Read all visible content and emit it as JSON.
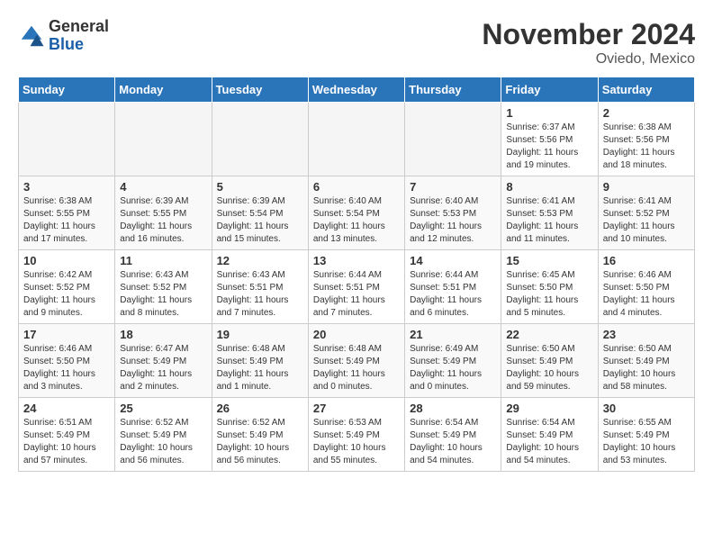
{
  "logo": {
    "general": "General",
    "blue": "Blue"
  },
  "title": "November 2024",
  "location": "Oviedo, Mexico",
  "days_of_week": [
    "Sunday",
    "Monday",
    "Tuesday",
    "Wednesday",
    "Thursday",
    "Friday",
    "Saturday"
  ],
  "weeks": [
    [
      {
        "day": "",
        "info": "",
        "empty": true
      },
      {
        "day": "",
        "info": "",
        "empty": true
      },
      {
        "day": "",
        "info": "",
        "empty": true
      },
      {
        "day": "",
        "info": "",
        "empty": true
      },
      {
        "day": "",
        "info": "",
        "empty": true
      },
      {
        "day": "1",
        "info": "Sunrise: 6:37 AM\nSunset: 5:56 PM\nDaylight: 11 hours and 19 minutes.",
        "empty": false
      },
      {
        "day": "2",
        "info": "Sunrise: 6:38 AM\nSunset: 5:56 PM\nDaylight: 11 hours and 18 minutes.",
        "empty": false
      }
    ],
    [
      {
        "day": "3",
        "info": "Sunrise: 6:38 AM\nSunset: 5:55 PM\nDaylight: 11 hours and 17 minutes.",
        "empty": false
      },
      {
        "day": "4",
        "info": "Sunrise: 6:39 AM\nSunset: 5:55 PM\nDaylight: 11 hours and 16 minutes.",
        "empty": false
      },
      {
        "day": "5",
        "info": "Sunrise: 6:39 AM\nSunset: 5:54 PM\nDaylight: 11 hours and 15 minutes.",
        "empty": false
      },
      {
        "day": "6",
        "info": "Sunrise: 6:40 AM\nSunset: 5:54 PM\nDaylight: 11 hours and 13 minutes.",
        "empty": false
      },
      {
        "day": "7",
        "info": "Sunrise: 6:40 AM\nSunset: 5:53 PM\nDaylight: 11 hours and 12 minutes.",
        "empty": false
      },
      {
        "day": "8",
        "info": "Sunrise: 6:41 AM\nSunset: 5:53 PM\nDaylight: 11 hours and 11 minutes.",
        "empty": false
      },
      {
        "day": "9",
        "info": "Sunrise: 6:41 AM\nSunset: 5:52 PM\nDaylight: 11 hours and 10 minutes.",
        "empty": false
      }
    ],
    [
      {
        "day": "10",
        "info": "Sunrise: 6:42 AM\nSunset: 5:52 PM\nDaylight: 11 hours and 9 minutes.",
        "empty": false
      },
      {
        "day": "11",
        "info": "Sunrise: 6:43 AM\nSunset: 5:52 PM\nDaylight: 11 hours and 8 minutes.",
        "empty": false
      },
      {
        "day": "12",
        "info": "Sunrise: 6:43 AM\nSunset: 5:51 PM\nDaylight: 11 hours and 7 minutes.",
        "empty": false
      },
      {
        "day": "13",
        "info": "Sunrise: 6:44 AM\nSunset: 5:51 PM\nDaylight: 11 hours and 7 minutes.",
        "empty": false
      },
      {
        "day": "14",
        "info": "Sunrise: 6:44 AM\nSunset: 5:51 PM\nDaylight: 11 hours and 6 minutes.",
        "empty": false
      },
      {
        "day": "15",
        "info": "Sunrise: 6:45 AM\nSunset: 5:50 PM\nDaylight: 11 hours and 5 minutes.",
        "empty": false
      },
      {
        "day": "16",
        "info": "Sunrise: 6:46 AM\nSunset: 5:50 PM\nDaylight: 11 hours and 4 minutes.",
        "empty": false
      }
    ],
    [
      {
        "day": "17",
        "info": "Sunrise: 6:46 AM\nSunset: 5:50 PM\nDaylight: 11 hours and 3 minutes.",
        "empty": false
      },
      {
        "day": "18",
        "info": "Sunrise: 6:47 AM\nSunset: 5:49 PM\nDaylight: 11 hours and 2 minutes.",
        "empty": false
      },
      {
        "day": "19",
        "info": "Sunrise: 6:48 AM\nSunset: 5:49 PM\nDaylight: 11 hours and 1 minute.",
        "empty": false
      },
      {
        "day": "20",
        "info": "Sunrise: 6:48 AM\nSunset: 5:49 PM\nDaylight: 11 hours and 0 minutes.",
        "empty": false
      },
      {
        "day": "21",
        "info": "Sunrise: 6:49 AM\nSunset: 5:49 PM\nDaylight: 11 hours and 0 minutes.",
        "empty": false
      },
      {
        "day": "22",
        "info": "Sunrise: 6:50 AM\nSunset: 5:49 PM\nDaylight: 10 hours and 59 minutes.",
        "empty": false
      },
      {
        "day": "23",
        "info": "Sunrise: 6:50 AM\nSunset: 5:49 PM\nDaylight: 10 hours and 58 minutes.",
        "empty": false
      }
    ],
    [
      {
        "day": "24",
        "info": "Sunrise: 6:51 AM\nSunset: 5:49 PM\nDaylight: 10 hours and 57 minutes.",
        "empty": false
      },
      {
        "day": "25",
        "info": "Sunrise: 6:52 AM\nSunset: 5:49 PM\nDaylight: 10 hours and 56 minutes.",
        "empty": false
      },
      {
        "day": "26",
        "info": "Sunrise: 6:52 AM\nSunset: 5:49 PM\nDaylight: 10 hours and 56 minutes.",
        "empty": false
      },
      {
        "day": "27",
        "info": "Sunrise: 6:53 AM\nSunset: 5:49 PM\nDaylight: 10 hours and 55 minutes.",
        "empty": false
      },
      {
        "day": "28",
        "info": "Sunrise: 6:54 AM\nSunset: 5:49 PM\nDaylight: 10 hours and 54 minutes.",
        "empty": false
      },
      {
        "day": "29",
        "info": "Sunrise: 6:54 AM\nSunset: 5:49 PM\nDaylight: 10 hours and 54 minutes.",
        "empty": false
      },
      {
        "day": "30",
        "info": "Sunrise: 6:55 AM\nSunset: 5:49 PM\nDaylight: 10 hours and 53 minutes.",
        "empty": false
      }
    ]
  ]
}
